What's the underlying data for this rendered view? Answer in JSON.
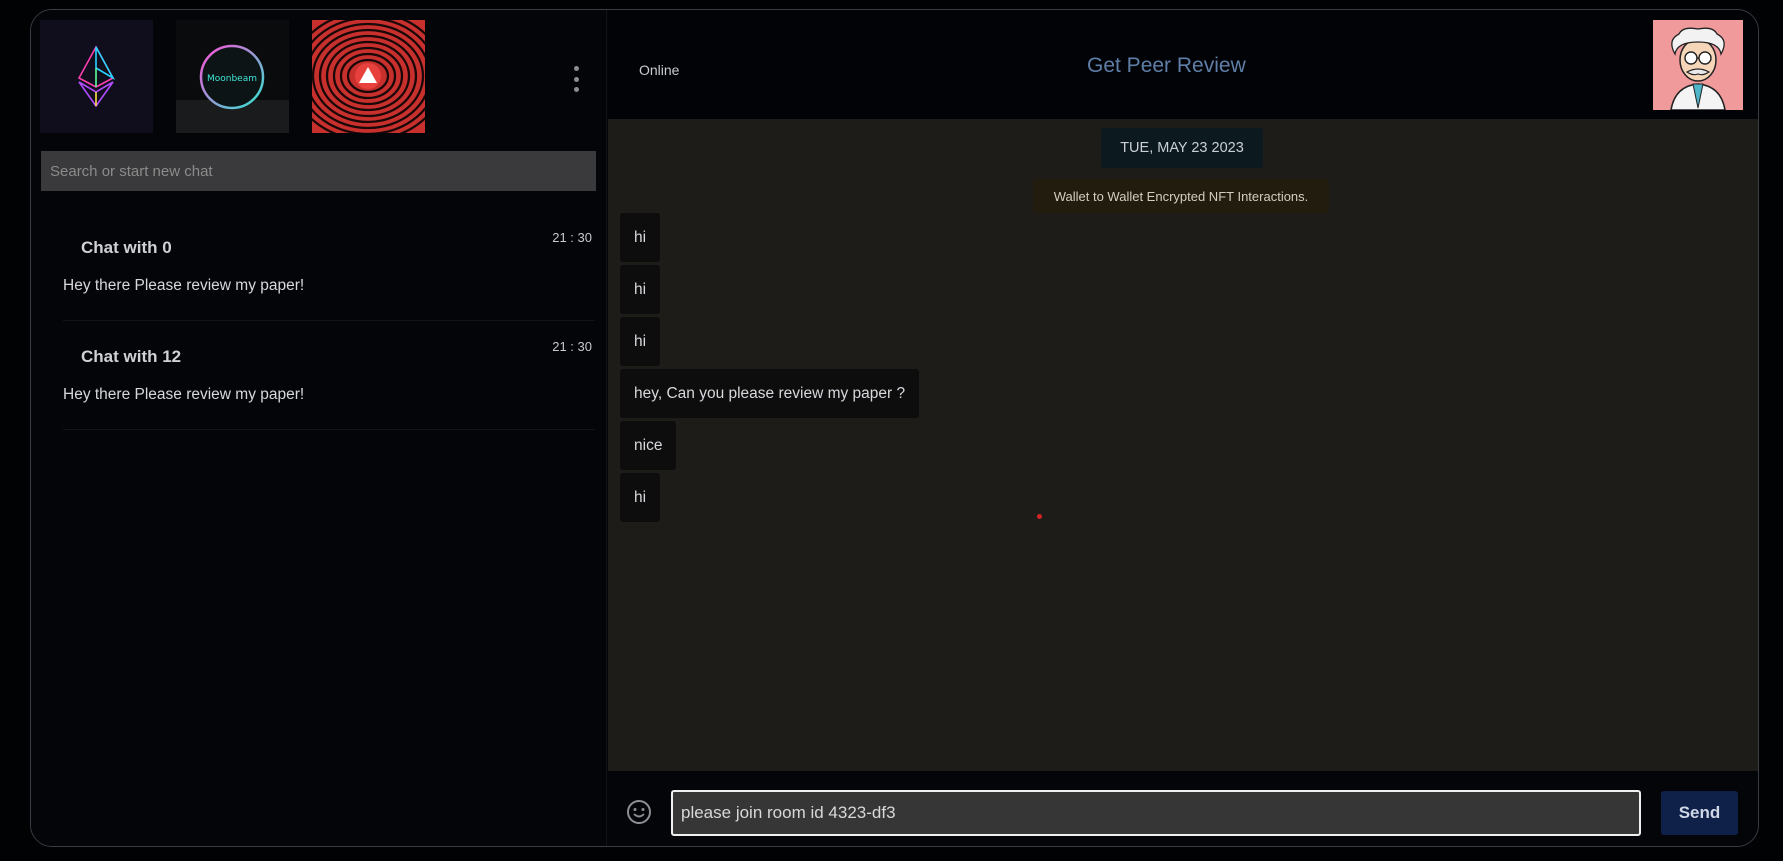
{
  "header": {
    "status": "Online",
    "title": "Get Peer Review",
    "avatar_icon": "scientist-avatar-icon"
  },
  "collections": [
    {
      "name": "ethereum-logo-image",
      "label": ""
    },
    {
      "name": "moonbeam-logo-image",
      "label": "Moonbeam"
    },
    {
      "name": "avalanche-logo-image",
      "label": ""
    }
  ],
  "menu_icon": "kebab-menu-icon",
  "search": {
    "placeholder": "Search or start new chat",
    "value": ""
  },
  "chats": [
    {
      "title": "Chat with 0",
      "time": "21 : 30",
      "preview": "Hey there Please review my paper!"
    },
    {
      "title": "Chat with 12",
      "time": "21 : 30",
      "preview": "Hey there Please review my paper!"
    }
  ],
  "conversation": {
    "date": "TUE, MAY 23 2023",
    "notice": "Wallet to Wallet Encrypted NFT Interactions.",
    "messages": [
      {
        "text": "hi"
      },
      {
        "text": "hi"
      },
      {
        "text": "hi"
      },
      {
        "text": "hey, Can you please review my paper ?"
      },
      {
        "text": "nice"
      },
      {
        "text": "hi"
      }
    ]
  },
  "composer": {
    "emoji_icon": "emoji-smile-icon",
    "input_value": "please join room id 4323-df3",
    "send_label": "Send"
  },
  "colors": {
    "background": "#010204",
    "panel": "#030508",
    "messages_bg": "#1e1c19",
    "title": "#5f7fa8",
    "send_button": "#0f2149",
    "search_bg": "#3a3a3c"
  }
}
